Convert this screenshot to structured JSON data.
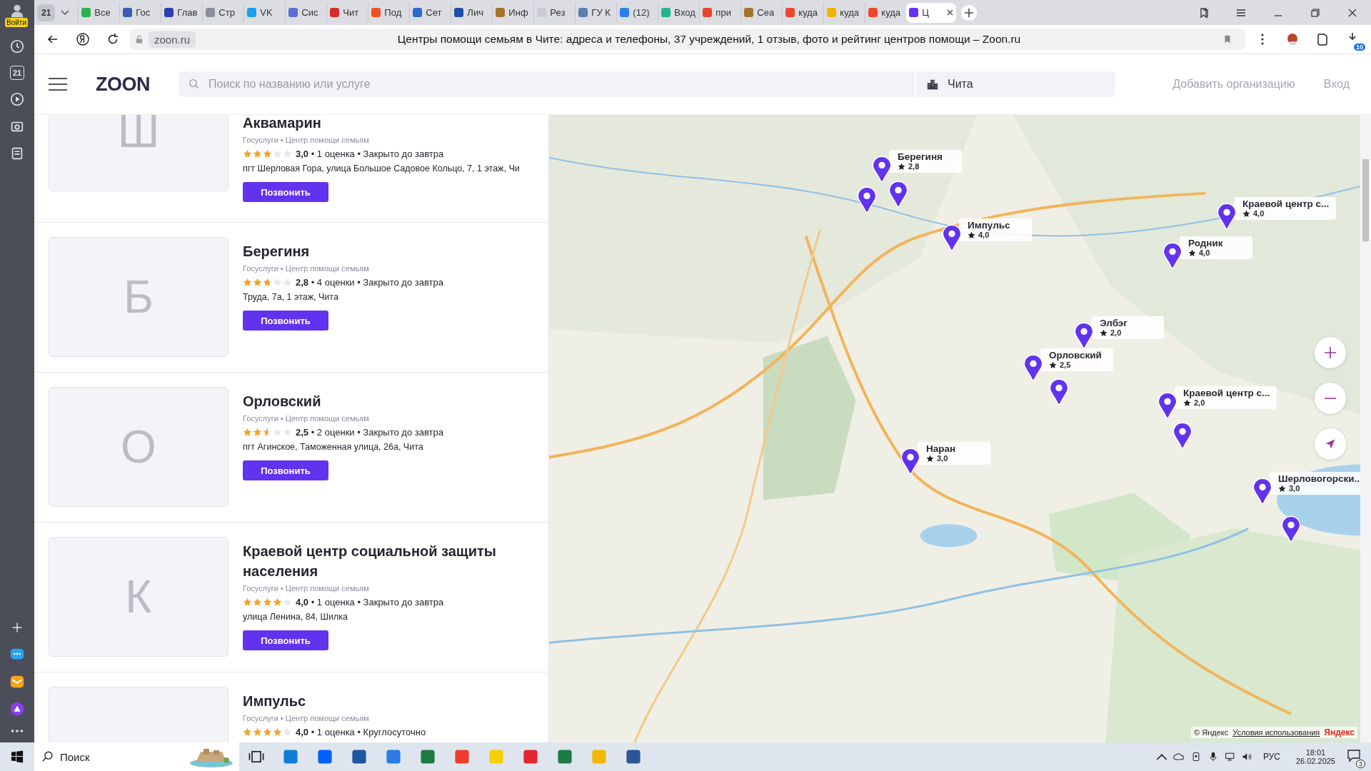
{
  "browser": {
    "user_label": "Войти",
    "calendar_day": "21",
    "tab_count": "21",
    "tabs": [
      {
        "title": "Все",
        "color": "#2bb24c",
        "selected": false
      },
      {
        "title": "Гос",
        "color": "#3a5bb8",
        "selected": false
      },
      {
        "title": "Глав",
        "color": "#2a3fb0",
        "selected": false
      },
      {
        "title": "Стр",
        "color": "#8a8f99",
        "selected": false
      },
      {
        "title": "VK",
        "color": "#19a0f0",
        "selected": false
      },
      {
        "title": "Сис",
        "color": "#5a6fd6",
        "selected": false
      },
      {
        "title": "Чит",
        "color": "#d52a2a",
        "selected": false
      },
      {
        "title": "Под",
        "color": "#f04e23",
        "selected": false
      },
      {
        "title": "Сет",
        "color": "#2c6bd1",
        "selected": false
      },
      {
        "title": "Лич",
        "color": "#1e4fa8",
        "selected": false
      },
      {
        "title": "Инф",
        "color": "#a5742a",
        "selected": false
      },
      {
        "title": "Рез",
        "color": "#c9ccd3",
        "selected": false
      },
      {
        "title": "ГУ К",
        "color": "#5b7fb0",
        "selected": false
      },
      {
        "title": "(12)",
        "color": "#2b7ef0",
        "selected": false
      },
      {
        "title": "Вход",
        "color": "#1fb58f",
        "selected": false
      },
      {
        "title": "при",
        "color": "#e8452c",
        "selected": false
      },
      {
        "title": "Сеа",
        "color": "#a5742a",
        "selected": false
      },
      {
        "title": "куда",
        "color": "#f0452c",
        "selected": false
      },
      {
        "title": "куда",
        "color": "#f0b400",
        "selected": false
      },
      {
        "title": "куда",
        "color": "#f0452c",
        "selected": false
      },
      {
        "title": "Ц",
        "color": "#6233ee",
        "selected": true
      }
    ],
    "address": {
      "domain": "zoon.ru",
      "page_title": "Центры помощи семьям в Чите: адреса и телефоны, 37 учреждений, 1 отзыв, фото и рейтинг центров помощи – Zoon.ru"
    },
    "downloads_badge": "10"
  },
  "header": {
    "logo": "ZOON",
    "search": {
      "placeholder": "Поиск по названию или услуге"
    },
    "city": "Чита",
    "add_link": "Добавить организацию",
    "login": "Вход"
  },
  "places": [
    {
      "letter": "Ш",
      "name": "Аквамарин",
      "category": "Госуслуги • Центр помощи семьям",
      "stars": 3,
      "rating": "3,0",
      "details": "• 1 оценка • Закрыто до завтра",
      "address": "пгт Шерловая Гора, улица Большое Садовое Кольцо, 7, 1 этаж, Чи",
      "call": "Позвонить"
    },
    {
      "letter": "Б",
      "name": "Берегиня",
      "category": "Госуслуги • Центр помощи семьям",
      "stars": 2.8,
      "rating": "2,8",
      "details": "• 4 оценки • Закрыто до завтра",
      "address": "Труда, 7а, 1 этаж, Чита",
      "call": "Позвонить"
    },
    {
      "letter": "О",
      "name": "Орловский",
      "category": "Госуслуги • Центр помощи семьям",
      "stars": 2.5,
      "rating": "2,5",
      "details": "• 2 оценки • Закрыто до завтра",
      "address": "пгт Агинское, Таможенная улица, 26а, Чита",
      "call": "Позвонить"
    },
    {
      "letter": "К",
      "name": "Краевой центр социальной защиты населения",
      "category": "Госуслуги • Центр помощи семьям",
      "stars": 4,
      "rating": "4,0",
      "details": "• 1 оценка • Закрыто до завтра",
      "address": "улица Ленина, 84, Шилка",
      "call": "Позвонить"
    },
    {
      "name": "Импульс",
      "category": "Госуслуги • Центр помощи семьям",
      "stars": 4,
      "rating": "4,0",
      "details": "• 1 оценка • Круглосуточно"
    }
  ],
  "map": {
    "kind": "picture",
    "markers": [
      {
        "kind": "label",
        "name": "Берегиня",
        "rating": "2,8"
      },
      {
        "kind": "pin"
      },
      {
        "kind": "pin"
      },
      {
        "kind": "label",
        "name": "Импульс",
        "rating": "4,0"
      },
      {
        "kind": "label",
        "name": "Краевой центр с...",
        "rating": "4,0"
      },
      {
        "kind": "label",
        "name": "Родник",
        "rating": "4,0"
      },
      {
        "kind": "label",
        "name": "Элбэг",
        "rating": "2,0"
      },
      {
        "kind": "label",
        "name": "Орловский",
        "rating": "2,5"
      },
      {
        "kind": "pin"
      },
      {
        "kind": "label",
        "name": "Краевой центр с...",
        "rating": "2,0"
      },
      {
        "kind": "pin"
      },
      {
        "kind": "label",
        "name": "Наран",
        "rating": "3,0"
      },
      {
        "kind": "label",
        "name": "Шерловогорски...",
        "rating": "3,0"
      },
      {
        "kind": "pin"
      }
    ],
    "copyright": "© Яндекс",
    "terms_link": "Условия использования",
    "provider_logo": "Яндекс"
  },
  "taskbar": {
    "search_placeholder": "Поиск",
    "language": "РУС",
    "time": "18:01",
    "date": "26.02.2025",
    "notifications": "3"
  }
}
